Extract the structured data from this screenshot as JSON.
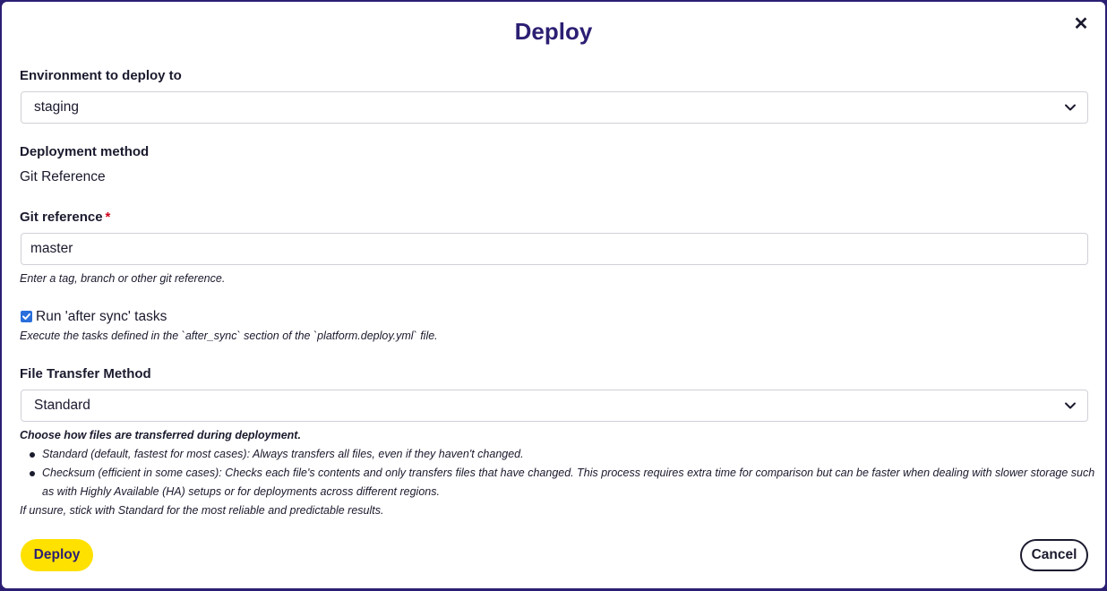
{
  "dialog": {
    "title": "Deploy",
    "close_icon": "close-icon"
  },
  "environment": {
    "label": "Environment to deploy to",
    "selected": "staging"
  },
  "deployment_method": {
    "label": "Deployment method",
    "value": "Git Reference"
  },
  "git_reference": {
    "label": "Git reference",
    "required_marker": "*",
    "value": "master",
    "hint": "Enter a tag, branch or other git reference."
  },
  "after_sync": {
    "checked": true,
    "label": "Run 'after sync' tasks",
    "hint": "Execute the tasks defined in the `after_sync` section of the `platform.deploy.yml` file."
  },
  "file_transfer": {
    "label": "File Transfer Method",
    "selected": "Standard",
    "help_heading": "Choose how files are transferred during deployment.",
    "options": [
      "Standard (default, fastest for most cases): Always transfers all files, even if they haven't changed.",
      "Checksum (efficient in some cases): Checks each file's contents and only transfers files that have changed. This process requires extra time for comparison but can be faster when dealing with slower storage such as with Highly Available (HA) setups or for deployments across different regions."
    ],
    "footer_hint": "If unsure, stick with Standard for the most reliable and predictable results."
  },
  "actions": {
    "deploy_label": "Deploy",
    "cancel_label": "Cancel"
  },
  "colors": {
    "title": "#2b1f73",
    "deploy_button_bg": "#ffe100",
    "checkbox": "#2a6fdb",
    "required": "#d0021b"
  }
}
